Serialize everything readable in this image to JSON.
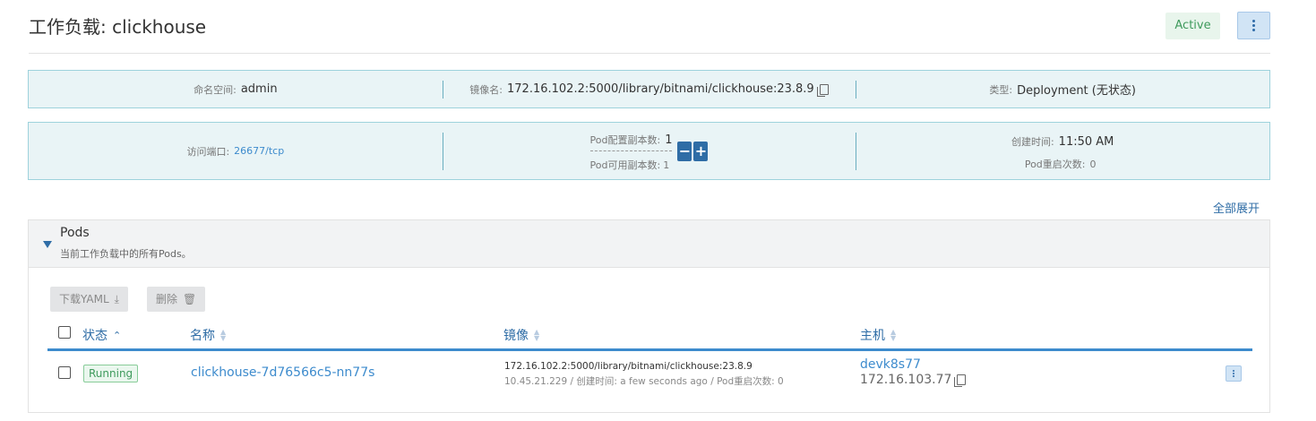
{
  "header": {
    "title": "工作负载: clickhouse",
    "status": "Active"
  },
  "info_row1": {
    "namespace_label": "命名空间:",
    "namespace_value": "admin",
    "image_label": "镜像名:",
    "image_value": "172.16.102.2:5000/library/bitnami/clickhouse:23.8.9",
    "type_label": "类型:",
    "type_value": "Deployment (无状态)"
  },
  "info_row2": {
    "port_label": "访问端口:",
    "port_value": "26677/tcp",
    "replicas_label": "Pod配置副本数:",
    "replicas_value": "1",
    "available_label": "Pod可用副本数:",
    "available_value": "1",
    "decrement_label": "−",
    "increment_label": "+",
    "created_label": "创建时间:",
    "created_value": "11:50 AM",
    "restarts_label": "Pod重启次数:",
    "restarts_value": "0"
  },
  "expand_all": "全部展开",
  "pods": {
    "title": "Pods",
    "subtitle": "当前工作负载中的所有Pods。",
    "download_yaml": "下载YAML",
    "delete": "删除",
    "columns": {
      "status": "状态",
      "name": "名称",
      "image": "镜像",
      "host": "主机"
    },
    "rows": [
      {
        "status": "Running",
        "name": "clickhouse-7d76566c5-nn77s",
        "image": "172.16.102.2:5000/library/bitnami/clickhouse:23.8.9",
        "meta": "10.45.21.229 / 创建时间: a few seconds ago / Pod重启次数: 0",
        "host": "devk8s77",
        "host_ip": "172.16.103.77"
      }
    ]
  }
}
